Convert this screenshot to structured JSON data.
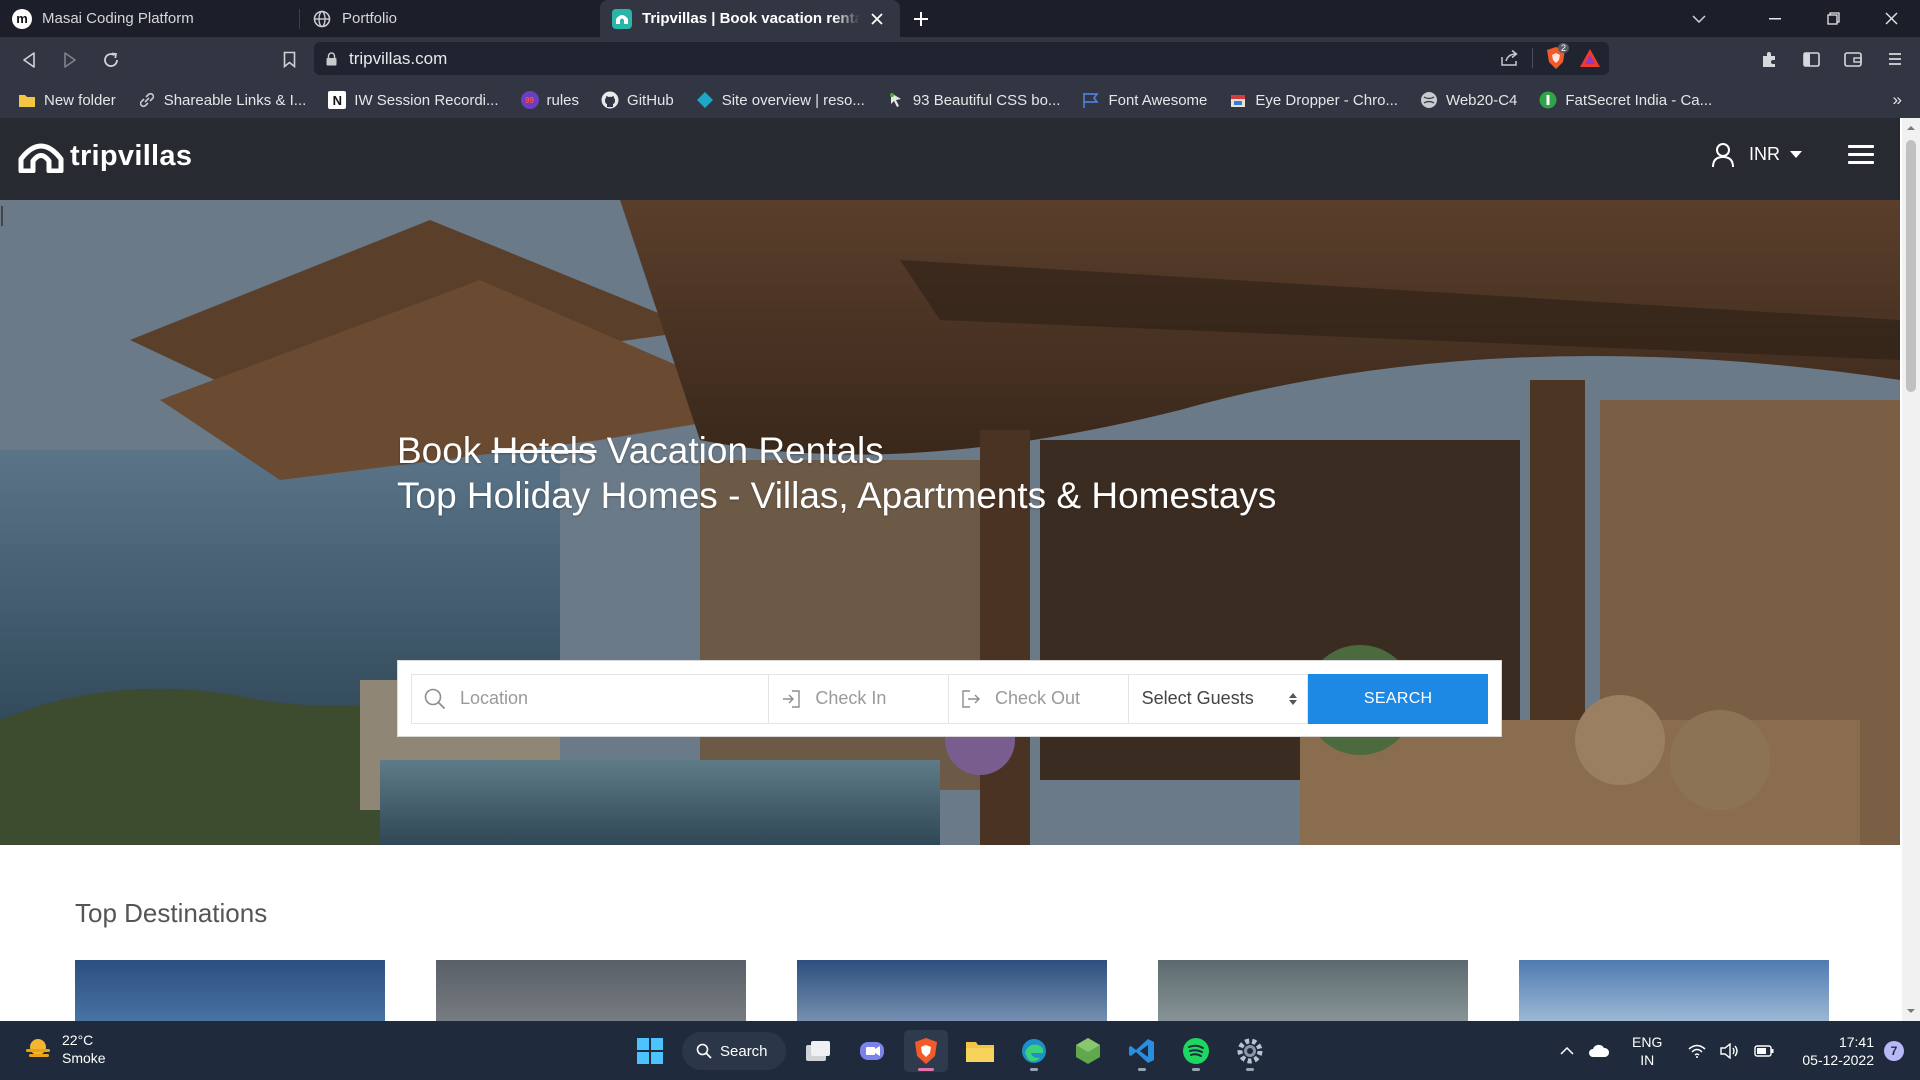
{
  "browser": {
    "tabs": [
      {
        "title": "Masai Coding Platform",
        "icon": "masai-logo-icon"
      },
      {
        "title": "Portfolio",
        "icon": "globe-icon"
      },
      {
        "title": "Tripvillas | Book vacation rentals, I",
        "icon": "tripvillas-favicon-icon",
        "active": true
      }
    ],
    "url": "tripvillas.com",
    "shields_count": "2",
    "bookmarks": [
      {
        "label": "New folder",
        "icon": "folder-icon"
      },
      {
        "label": "Shareable Links & I...",
        "icon": "link-icon"
      },
      {
        "label": "IW Session Recordi...",
        "icon": "notion-icon"
      },
      {
        "label": "rules",
        "icon": "badge-99-icon"
      },
      {
        "label": "GitHub",
        "icon": "github-icon"
      },
      {
        "label": "Site overview | reso...",
        "icon": "diamond-icon"
      },
      {
        "label": "93 Beautiful CSS bo...",
        "icon": "css-icon"
      },
      {
        "label": "Font Awesome",
        "icon": "flag-icon"
      },
      {
        "label": "Eye Dropper - Chro...",
        "icon": "eyedropper-icon"
      },
      {
        "label": "Web20-C4",
        "icon": "globe-icon"
      },
      {
        "label": "FatSecret India - Ca...",
        "icon": "fatsecret-icon"
      }
    ],
    "bookmarks_overflow": "»"
  },
  "site": {
    "brand": "tripvillas",
    "currency": "INR",
    "hero": {
      "line1_prefix": "Book ",
      "line1_strike": "Hotels",
      "line1_suffix": " Vacation Rentals",
      "line2": "Top Holiday Homes - Villas, Apartments & Homestays"
    },
    "search": {
      "location_placeholder": "Location",
      "checkin_placeholder": "Check In",
      "checkout_placeholder": "Check Out",
      "guests_selected": "Select Guests",
      "button": "SEARCH"
    },
    "top_destinations_title": "Top Destinations",
    "colors": {
      "accent": "#1e88e5",
      "header": "#272a30"
    }
  },
  "taskbar": {
    "weather": {
      "temp": "22°C",
      "condition": "Smoke"
    },
    "search_label": "Search",
    "lang_top": "ENG",
    "lang_bottom": "IN",
    "time": "17:41",
    "date": "05-12-2022",
    "notifications": "7"
  }
}
